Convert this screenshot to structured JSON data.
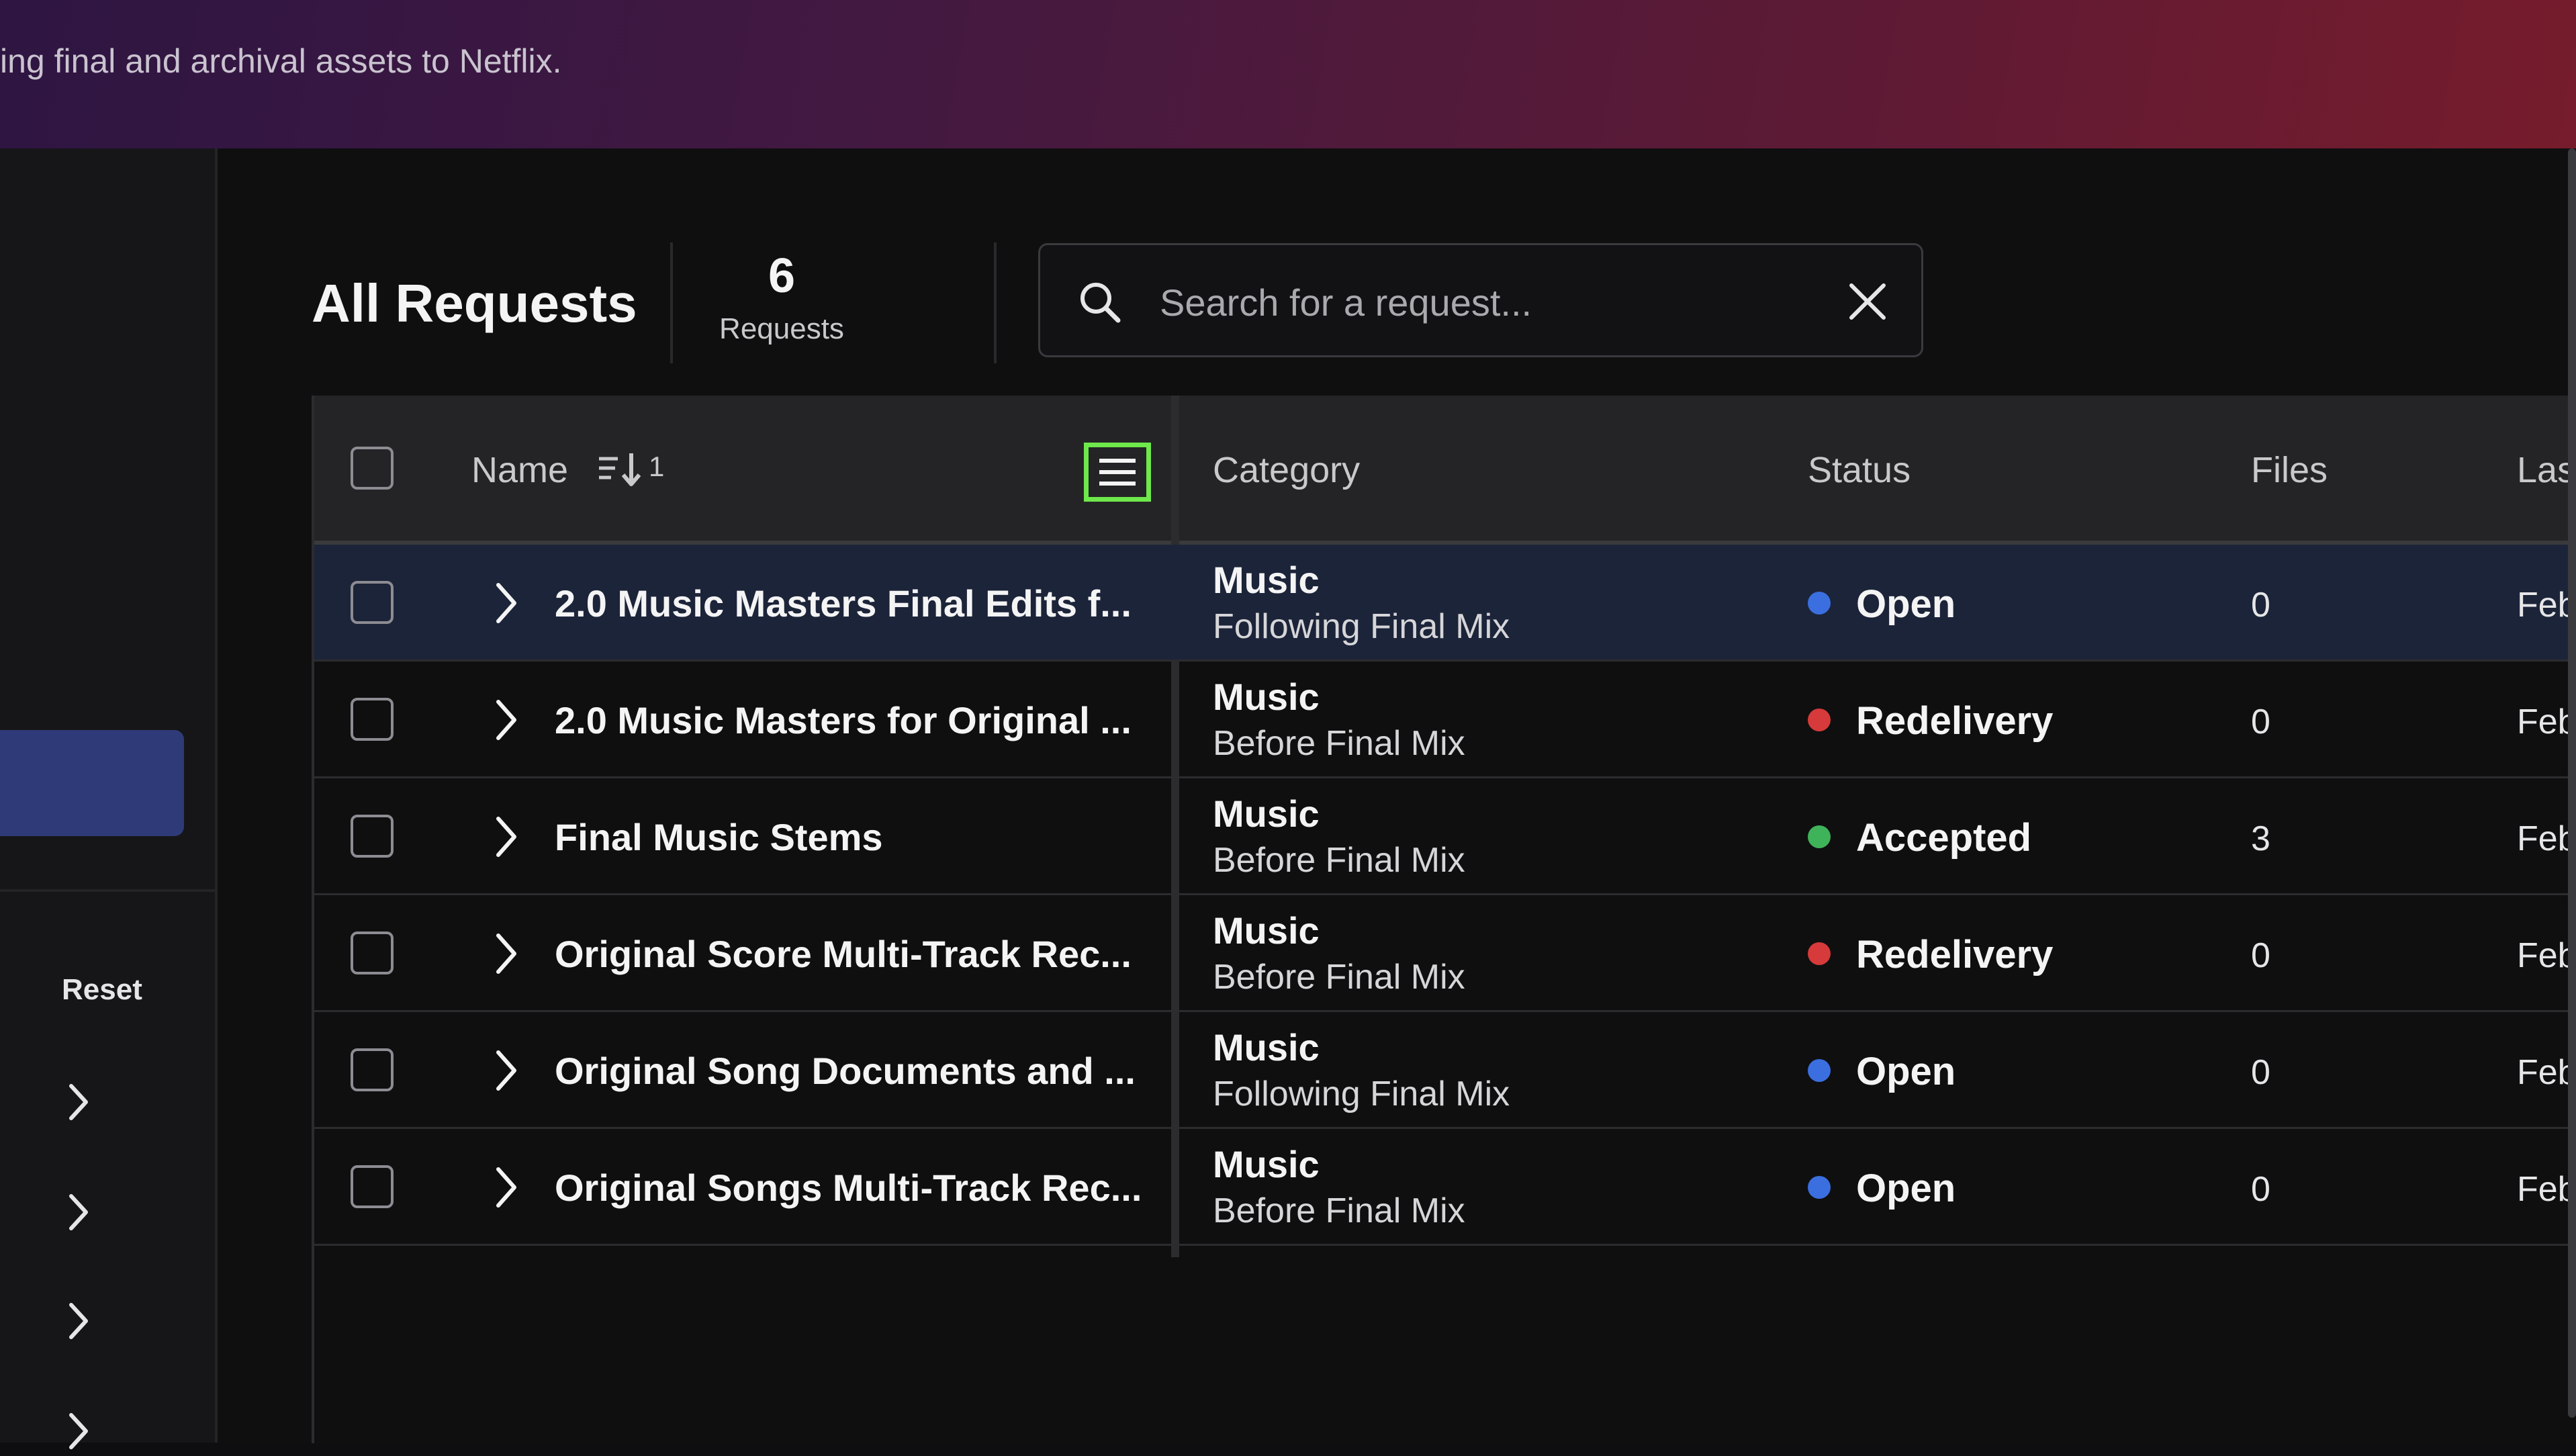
{
  "banner": {
    "text": "ing final and archival assets to Netflix."
  },
  "sidebar": {
    "reset_label": "Reset",
    "chevrons": [
      "chevron-right-icon",
      "chevron-right-icon",
      "chevron-right-icon",
      "chevron-right-icon"
    ]
  },
  "main": {
    "title": "All Requests",
    "count": "6",
    "count_label": "Requests",
    "search": {
      "placeholder": "Search for a request...",
      "value": ""
    }
  },
  "table": {
    "headers": {
      "name": "Name",
      "sort_order": "1",
      "category": "Category",
      "status": "Status",
      "files": "Files",
      "last": "Las"
    },
    "rows": [
      {
        "name": "2.0 Music Masters Final Edits f...",
        "category": "Music",
        "subcategory": "Following Final Mix",
        "status": "Open",
        "files": "0",
        "date": "Feb"
      },
      {
        "name": "2.0 Music Masters for Original ...",
        "category": "Music",
        "subcategory": "Before Final Mix",
        "status": "Redelivery",
        "files": "0",
        "date": "Feb"
      },
      {
        "name": "Final Music Stems",
        "category": "Music",
        "subcategory": "Before Final Mix",
        "status": "Accepted",
        "files": "3",
        "date": "Feb"
      },
      {
        "name": "Original Score Multi-Track Rec...",
        "category": "Music",
        "subcategory": "Before Final Mix",
        "status": "Redelivery",
        "files": "0",
        "date": "Feb"
      },
      {
        "name": "Original Song Documents and ...",
        "category": "Music",
        "subcategory": "Following Final Mix",
        "status": "Open",
        "files": "0",
        "date": "Feb"
      },
      {
        "name": "Original Songs Multi-Track Rec...",
        "category": "Music",
        "subcategory": "Before Final Mix",
        "status": "Open",
        "files": "0",
        "date": "Feb"
      }
    ],
    "status_colors": {
      "Open": "#3b6fe0",
      "Redelivery": "#d63a3a",
      "Accepted": "#3fb35a"
    }
  }
}
